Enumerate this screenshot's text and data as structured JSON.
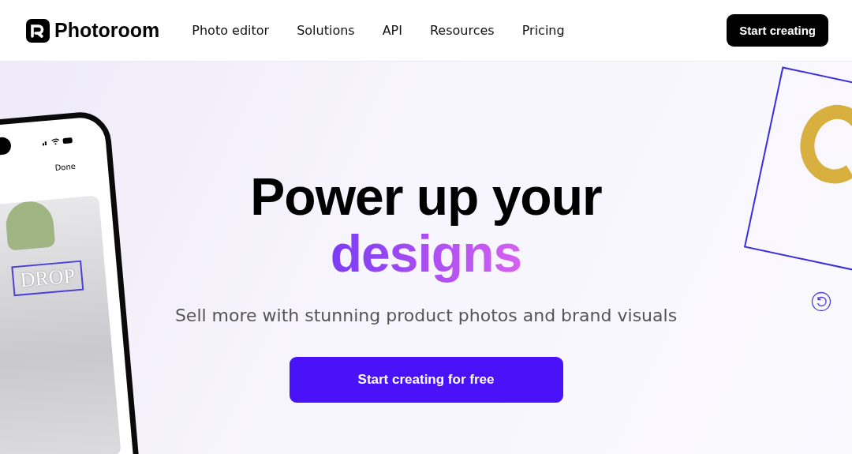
{
  "header": {
    "logo": "Photoroom",
    "nav": [
      "Photo editor",
      "Solutions",
      "API",
      "Resources",
      "Pricing"
    ],
    "cta": "Start creating"
  },
  "hero": {
    "title": "Power up your",
    "highlight": "designs",
    "subtitle": "Sell more with stunning product photos and brand visuals",
    "button": "Start creating for free"
  },
  "phone": {
    "done": "Done",
    "overlay_text": "DROP"
  }
}
